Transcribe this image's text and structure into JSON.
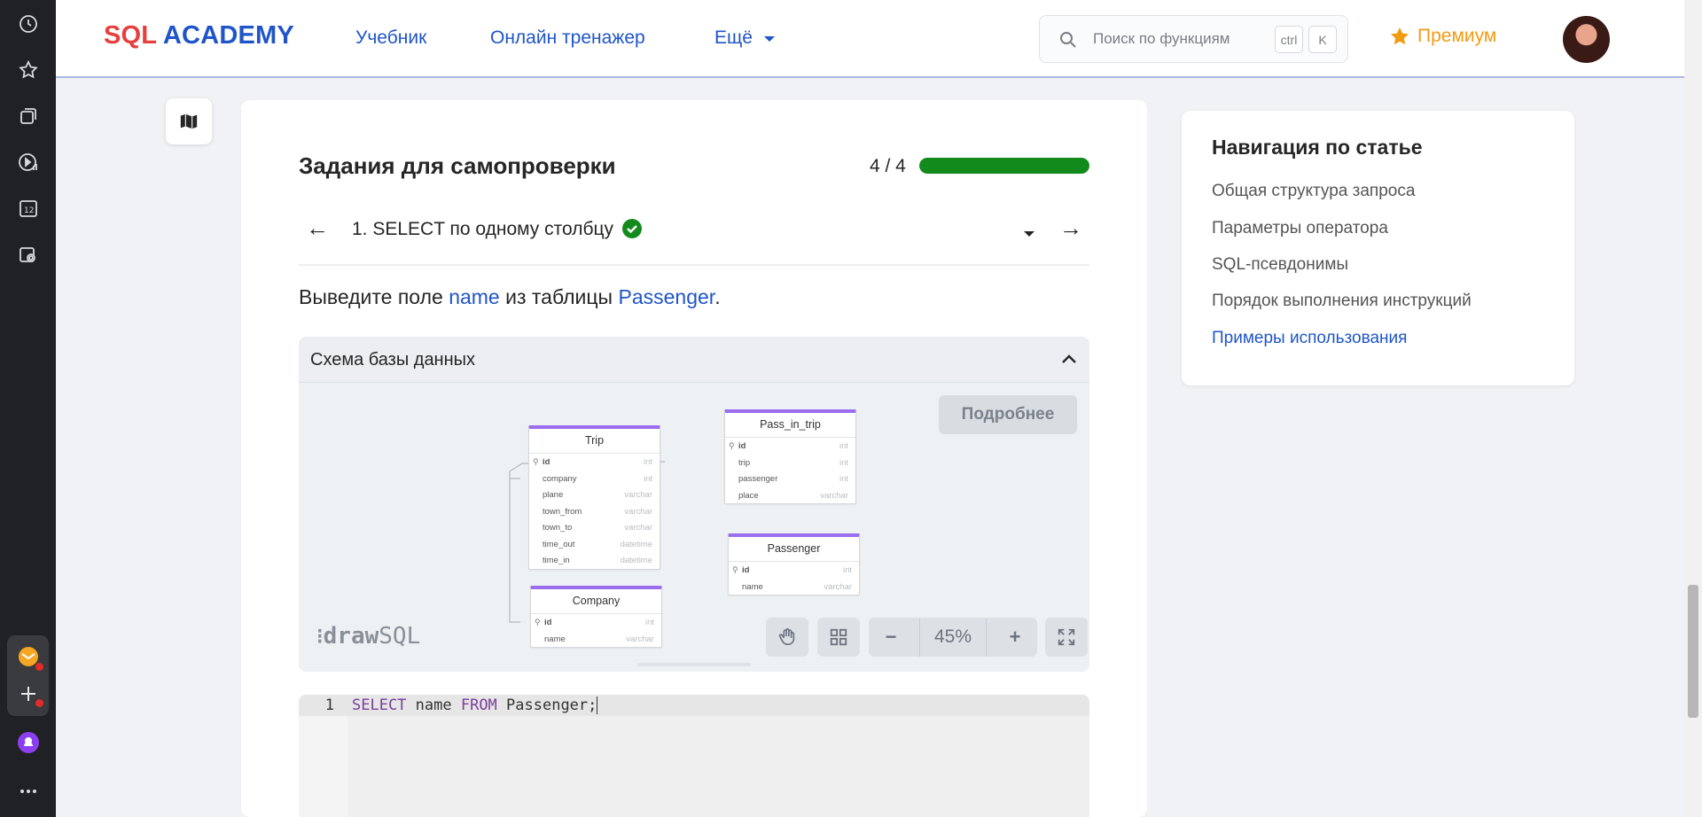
{
  "header": {
    "logo_part1": "SQL",
    "logo_part2": "ACADEMY",
    "nav": [
      "Учебник",
      "Онлайн тренажер",
      "Ещё"
    ],
    "search_placeholder": "Поиск по функциям",
    "shortcut_key1": "ctrl",
    "shortcut_key2": "K",
    "premium_label": "Премиум"
  },
  "task": {
    "section_title": "Задания для самопроверки",
    "progress_label": "4 / 4",
    "progress_fraction": 1.0,
    "current_task": "1. SELECT по одному столбцу",
    "desc_prefix": "Выведите поле",
    "desc_field": "name",
    "desc_middle": "из таблицы",
    "desc_table": "Passenger",
    "desc_suffix": "."
  },
  "schema": {
    "title": "Схема базы данных",
    "more_button": "Подробнее",
    "logo_bold": "draw",
    "logo_light": "SQL",
    "zoom_label": "45%",
    "tables": [
      {
        "name": "Trip",
        "rows": [
          [
            "id",
            "int"
          ],
          [
            "company",
            "int"
          ],
          [
            "plane",
            "varchar"
          ],
          [
            "town_from",
            "varchar"
          ],
          [
            "town_to",
            "varchar"
          ],
          [
            "time_out",
            "datetime"
          ],
          [
            "time_in",
            "datetime"
          ]
        ]
      },
      {
        "name": "Pass_in_trip",
        "rows": [
          [
            "id",
            "int"
          ],
          [
            "trip",
            "int"
          ],
          [
            "passenger",
            "int"
          ],
          [
            "place",
            "varchar"
          ]
        ]
      },
      {
        "name": "Passenger",
        "rows": [
          [
            "id",
            "int"
          ],
          [
            "name",
            "varchar"
          ]
        ]
      },
      {
        "name": "Company",
        "rows": [
          [
            "id",
            "int"
          ],
          [
            "name",
            "varchar"
          ]
        ]
      }
    ]
  },
  "editor": {
    "line_number": "1",
    "kw1": "SELECT",
    "col": " name ",
    "kw2": "FROM",
    "rest": " Passenger;"
  },
  "article_nav": {
    "title": "Навигация по статье",
    "items": [
      "Общая структура запроса",
      "Параметры оператора",
      "SQL-псевдонимы",
      "Порядок выполнения инструкций",
      "Примеры использования"
    ],
    "active_index": 4
  },
  "colors": {
    "brand_blue": "#1f55c8",
    "brand_red": "#e5403d",
    "progress_green": "#138a1c",
    "premium_orange": "#f29b11",
    "table_accent": "#9b6ef0"
  }
}
